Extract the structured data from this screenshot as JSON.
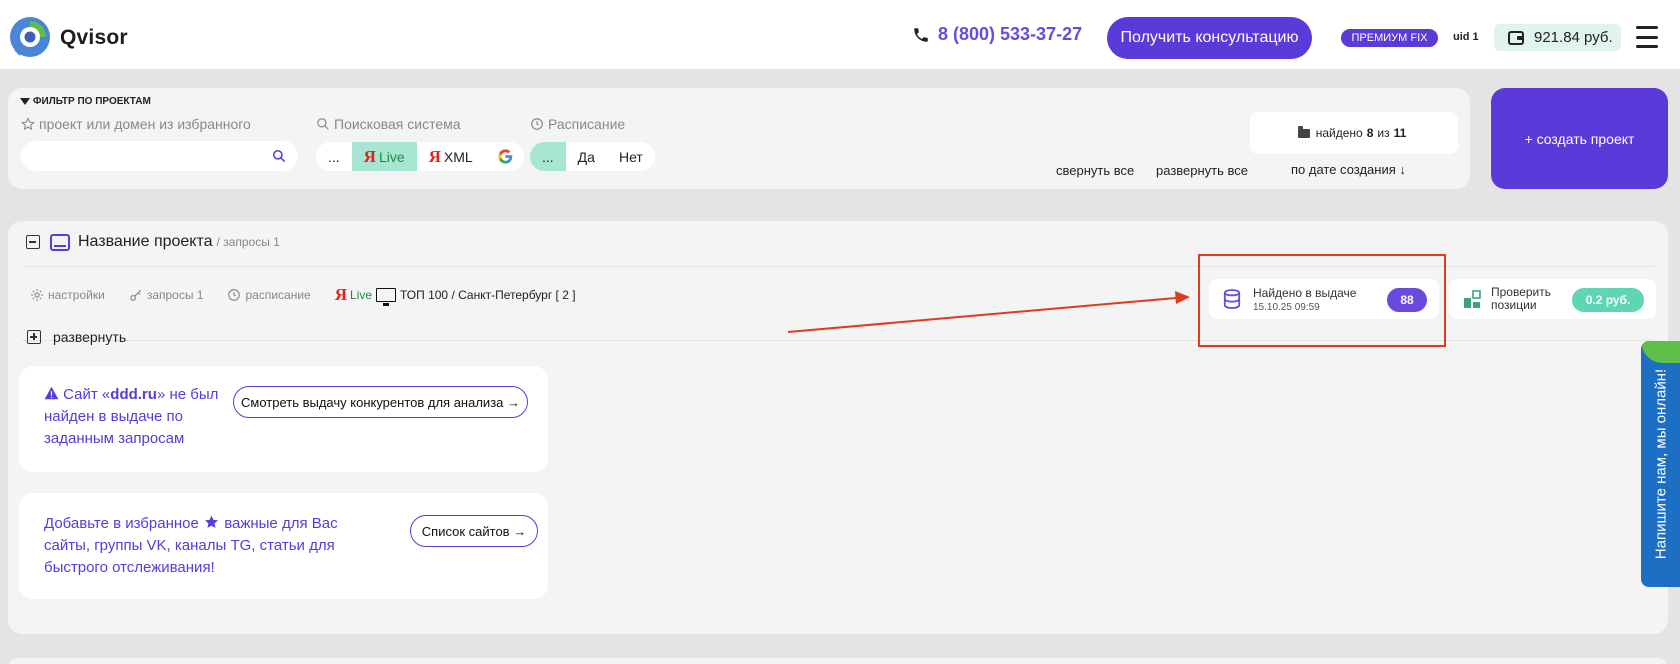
{
  "header": {
    "logo_text": "Qvisor",
    "phone": "8 (800) 533-37-27",
    "consult_button": "Получить консультацию",
    "plan_badge": "ПРЕМИУМ FIX",
    "uid": "uid 1",
    "balance": "921.84 руб."
  },
  "filter": {
    "title": "ФИЛЬТР ПО ПРОЕКТАМ",
    "project_label": "проект или домен из избранного",
    "search_value": "",
    "engine_label": "Поисковая система",
    "engine_options": [
      "...",
      "Live",
      "XML",
      "G"
    ],
    "schedule_label": "Расписание",
    "schedule_options": [
      "...",
      "Да",
      "Нет"
    ],
    "found_prefix": "найдено",
    "found_count": "8",
    "found_of": "из",
    "found_total": "11",
    "collapse_all": "свернуть все",
    "expand_all": "развернуть все",
    "sort": "по дате создания ↓"
  },
  "create_button": "+ создать проект",
  "project": {
    "name": "Название проекта",
    "subtitle": "/ запросы 1",
    "tools": {
      "settings": "настройки",
      "queries": "запросы 1",
      "schedule": "расписание",
      "engine": "Live",
      "region": "ТОП 100 / Санкт-Петербург [ 2 ]"
    },
    "expand": "развернуть",
    "found_card": {
      "title": "Найдено в выдаче",
      "date": "15.10.25 09:59",
      "badge": "88"
    },
    "check_card": {
      "line1": "Проверить",
      "line2": "позиции",
      "price": "0.2 руб."
    }
  },
  "notice1": {
    "text_a": "Сайт «",
    "domain": "ddd.ru",
    "text_b": "» не был найден в выдаче по заданным запросам",
    "button": "Смотреть выдачу конкурентов для анализа →"
  },
  "notice2": {
    "text_a": "Добавьте в избранное",
    "text_b": "важные для Вас сайты, группы VK, каналы TG, статьи для быстрого отслеживания!",
    "button": "Список сайтов →"
  },
  "chat": {
    "text": "Напишите нам, мы онлайн!"
  },
  "colors": {
    "accent": "#5a3ad8",
    "mint": "#a6e6d3",
    "annotation": "#e03a22"
  }
}
